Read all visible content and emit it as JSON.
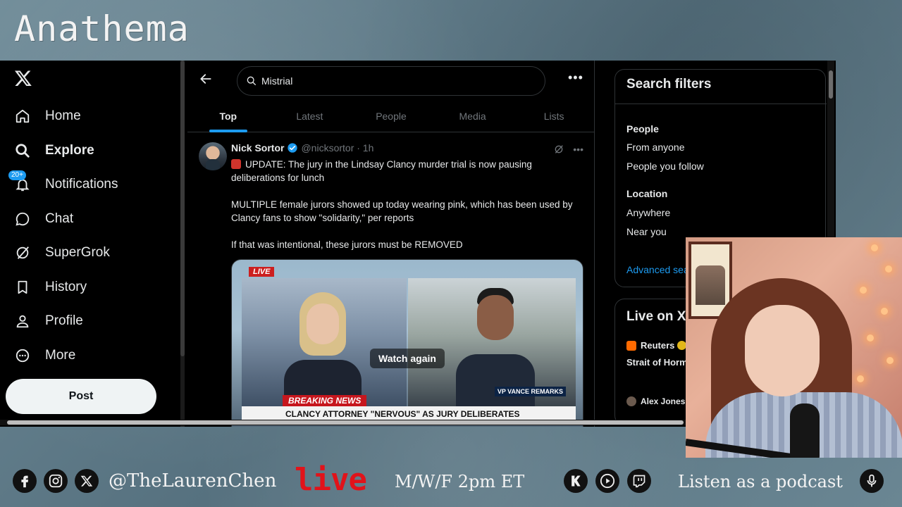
{
  "overlay": {
    "brand": "Anathema",
    "handle": "@TheLaurenChen",
    "live_word": "live",
    "schedule": "M/W/F  2pm ET",
    "podcast": "Listen as a podcast"
  },
  "nav": {
    "items": [
      {
        "label": "Home",
        "icon": "home-icon"
      },
      {
        "label": "Explore",
        "icon": "search-icon"
      },
      {
        "label": "Notifications",
        "icon": "bell-icon",
        "badge": "20+"
      },
      {
        "label": "Chat",
        "icon": "chat-icon"
      },
      {
        "label": "SuperGrok",
        "icon": "grok-icon"
      },
      {
        "label": "History",
        "icon": "bookmark-icon"
      },
      {
        "label": "Profile",
        "icon": "person-icon"
      },
      {
        "label": "More",
        "icon": "more-circle-icon"
      }
    ],
    "post_label": "Post"
  },
  "search": {
    "value": "Mistrial"
  },
  "tabs": [
    "Top",
    "Latest",
    "People",
    "Media",
    "Lists"
  ],
  "tweet": {
    "name": "Nick Sortor",
    "handle": "@nicksortor · 1h",
    "line1": "UPDATE: The jury in the Lindsay Clancy murder trial is now pausing deliberations for lunch",
    "line2": "MULTIPLE female jurors showed up today wearing pink, which has been used by Clancy fans to show \"solidarity,\" per reports",
    "line3": "If that was intentional, these jurors must be REMOVED",
    "media": {
      "live_tag": "LIVE",
      "watch_again": "Watch again",
      "breaking": "BREAKING NEWS",
      "chyron": "CLANCY ATTORNEY \"NERVOUS\" AS JURY DELIBERATES",
      "vp_tag": "VP VANCE REMARKS"
    }
  },
  "filters": {
    "title": "Search filters",
    "people_heading": "People",
    "people_opt1": "From anyone",
    "people_opt2": "People you follow",
    "location_heading": "Location",
    "location_opt1": "Anywhere",
    "location_opt2": "Near you",
    "advanced": "Advanced search"
  },
  "live_on_x": {
    "title": "Live on X",
    "source": "Reuters",
    "headline": "Strait of Hormuz … US, Iran resu…",
    "user": "Alex Jones"
  },
  "colors": {
    "accent": "#1d9bf0",
    "live_red": "#e1131a"
  }
}
